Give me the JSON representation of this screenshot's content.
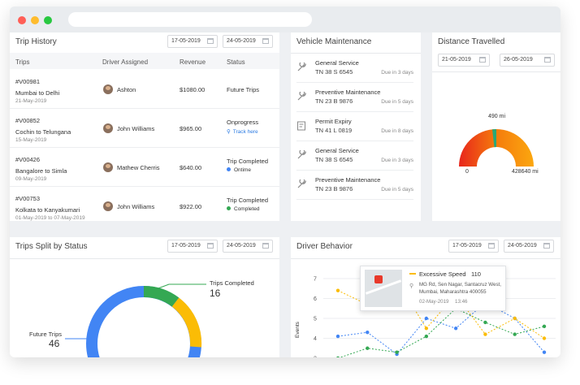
{
  "trip_history": {
    "title": "Trip History",
    "date_from": "17-05-2019",
    "date_to": "24-05-2019",
    "columns": [
      "Trips",
      "Driver Assigned",
      "Revenue",
      "Status"
    ],
    "rows": [
      {
        "id": "#V00981",
        "route": "Mumbai to Delhi",
        "date": "21-May-2019",
        "driver": "Ashton",
        "revenue": "$1080.00",
        "status": "Future Trips",
        "sub": ""
      },
      {
        "id": "#V00852",
        "route": "Cochin to Telungana",
        "date": "15-May-2019",
        "driver": "John Williams",
        "revenue": "$965.00",
        "status": "Onprogress",
        "sub": "Track here"
      },
      {
        "id": "#V00426",
        "route": "Bangalore to Simla",
        "date": "09-May-2019",
        "driver": "Mathew Cherris",
        "revenue": "$640.00",
        "status": "Trip Completed",
        "sub": "Ontime"
      },
      {
        "id": "#V00753",
        "route": "Kolkata to Kanyakumari",
        "date": "01-May-2019 to 07-May-2019",
        "driver": "John Williams",
        "revenue": "$922.00",
        "status": "Trip Completed",
        "sub": "Completed"
      }
    ]
  },
  "vehicle_maintenance": {
    "title": "Vehicle Maintenance",
    "items": [
      {
        "name": "General Service",
        "plate": "TN 38 S 6545",
        "due": "Due in 3 days",
        "icon": "wrench-icon"
      },
      {
        "name": "Preventive Maintenance",
        "plate": "TN 23 B 9876",
        "due": "Due in 5 days",
        "icon": "wrench-icon"
      },
      {
        "name": "Permit Expiry",
        "plate": "TN 41 L 0819",
        "due": "Due in 8 days",
        "icon": "permit-icon"
      },
      {
        "name": "General Service",
        "plate": "TN 38 S 6545",
        "due": "Due in 3 days",
        "icon": "wrench-icon"
      },
      {
        "name": "Preventive Maintenance",
        "plate": "TN 23 B 9876",
        "due": "Due in 5 days",
        "icon": "wrench-icon"
      }
    ]
  },
  "distance": {
    "title": "Distance Travelled",
    "date_from": "21-05-2019",
    "date_to": "26-05-2019",
    "value_label": "490 mi",
    "min_label": "0",
    "max_label": "428640 mi",
    "value": 490,
    "max": 428640
  },
  "trips_split": {
    "title": "Trips Split by Status",
    "date_from": "17-05-2019",
    "date_to": "24-05-2019",
    "completed_label": "Trips Completed",
    "completed_value": "16",
    "future_label": "Future Trips",
    "future_value": "46"
  },
  "driver_behavior": {
    "title": "Driver Behavior",
    "date_from": "17-05-2019",
    "date_to": "24-05-2019",
    "y_ticks": [
      "7",
      "6",
      "5",
      "4",
      "3"
    ],
    "y_label": "Events",
    "tooltip": {
      "event": "Excessive Speed",
      "count": "110",
      "address_line1": "MG Rd, Sen Nagar, Santacruz West,",
      "address_line2": "Mumbai, Maharashtra 400055",
      "date": "02-May-2019",
      "time": "13:46"
    }
  },
  "colors": {
    "blue": "#4285f4",
    "green": "#34a853",
    "amber": "#fbbc05",
    "red": "#ff5f57",
    "yellow": "#febc2e",
    "traffic_green": "#28c840"
  },
  "chart_data": {
    "type": "line",
    "x": [
      1,
      2,
      3,
      4,
      5,
      6,
      7,
      8
    ],
    "ylim": [
      3,
      7
    ],
    "series": [
      {
        "values": [
          4.1,
          4.3,
          3.2,
          5.0,
          4.5,
          5.8,
          5.0,
          3.3
        ]
      },
      {
        "values": [
          3.0,
          3.5,
          3.3,
          4.1,
          5.5,
          4.8,
          4.2,
          4.6
        ]
      },
      {
        "values": [
          6.4,
          5.7,
          6.9,
          4.5,
          6.2,
          4.2,
          5.0,
          4.0
        ]
      }
    ]
  }
}
